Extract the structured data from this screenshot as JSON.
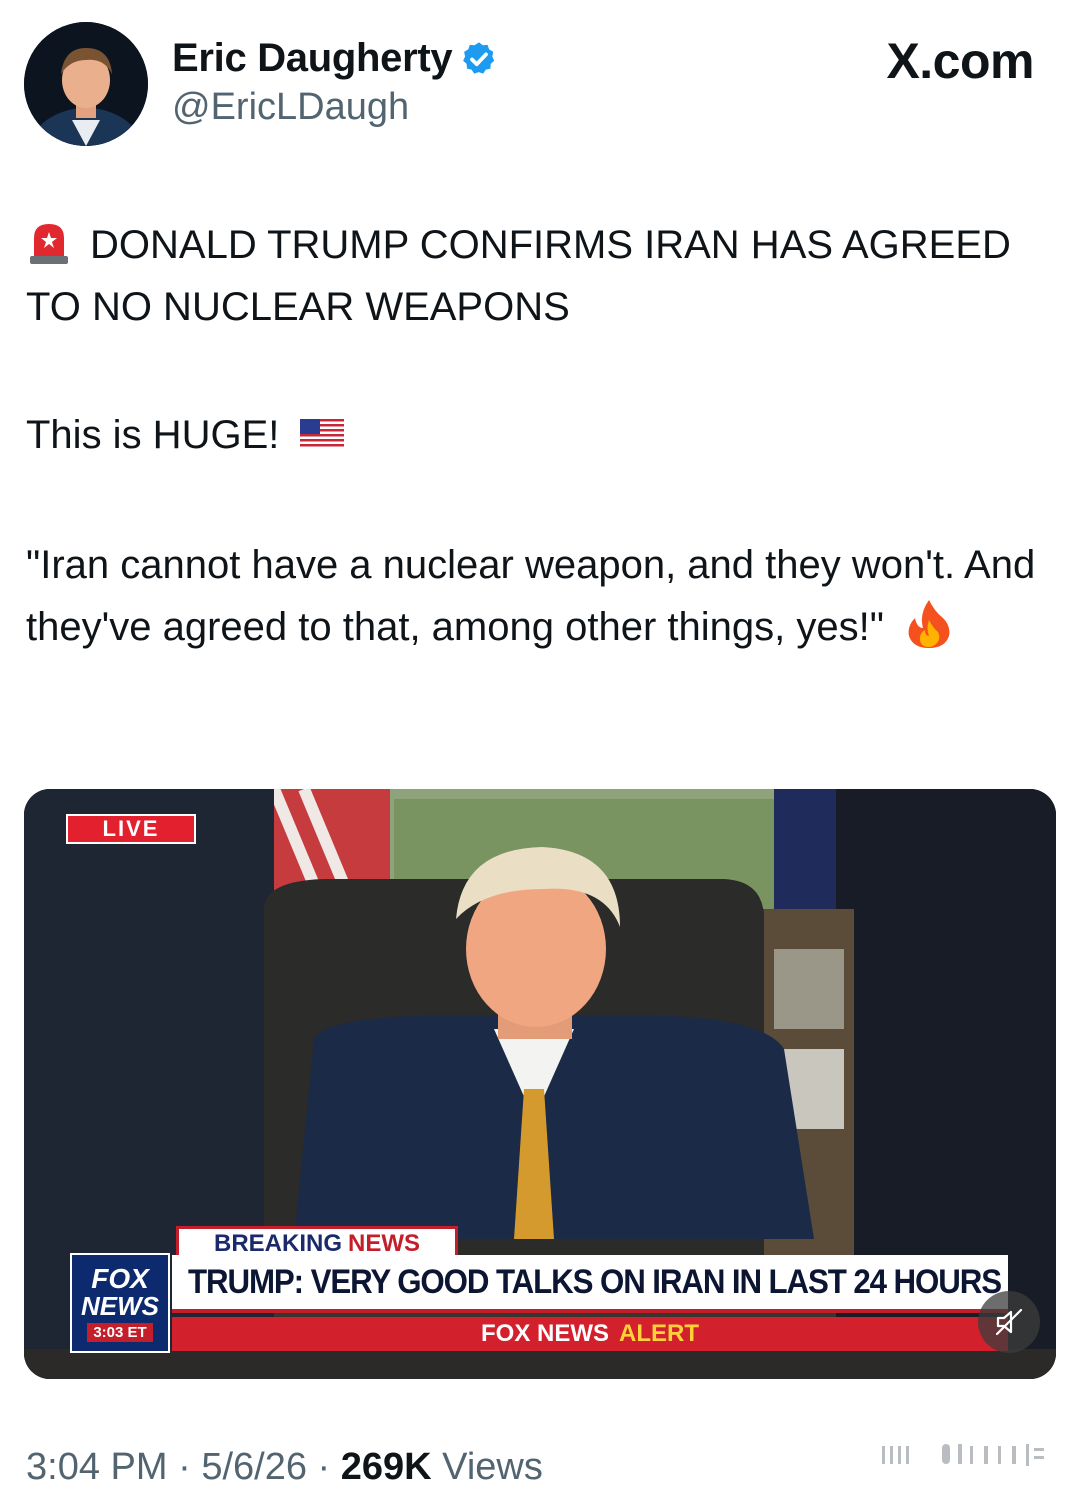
{
  "author": {
    "display_name": "Eric Daugherty",
    "handle": "@EricLDaugh",
    "verified": true
  },
  "site": "X.com",
  "tweet": {
    "paragraph_1": "DONALD TRUMP CONFIRMS IRAN HAS AGREED TO NO NUCLEAR WEAPONS",
    "paragraph_2": "This is HUGE!",
    "paragraph_3": "\"Iran cannot have a nuclear weapon, and they won't. And they've agreed to that, among other things, yes!\"",
    "emojis": [
      "rotating-light-icon",
      "us-flag-icon",
      "fire-icon"
    ]
  },
  "media": {
    "live_badge": "LIVE",
    "breaking_a": "BREAKING",
    "breaking_b": "NEWS",
    "headline": "TRUMP: VERY GOOD TALKS ON IRAN IN LAST 24 HOURS",
    "alert_a": "FOX NEWS",
    "alert_b": "ALERT",
    "logo_line_1": "FOX",
    "logo_line_2": "NEWS",
    "logo_time": "3:03 ET",
    "muted": true
  },
  "meta": {
    "time": "3:04 PM",
    "date": "5/6/26",
    "views_count": "269K",
    "views_label": "Views"
  },
  "colors": {
    "verified_blue": "#1d9bf0",
    "secondary_text": "#536471",
    "fox_red": "#c41e2b",
    "fox_navy": "#0e2a6e"
  }
}
